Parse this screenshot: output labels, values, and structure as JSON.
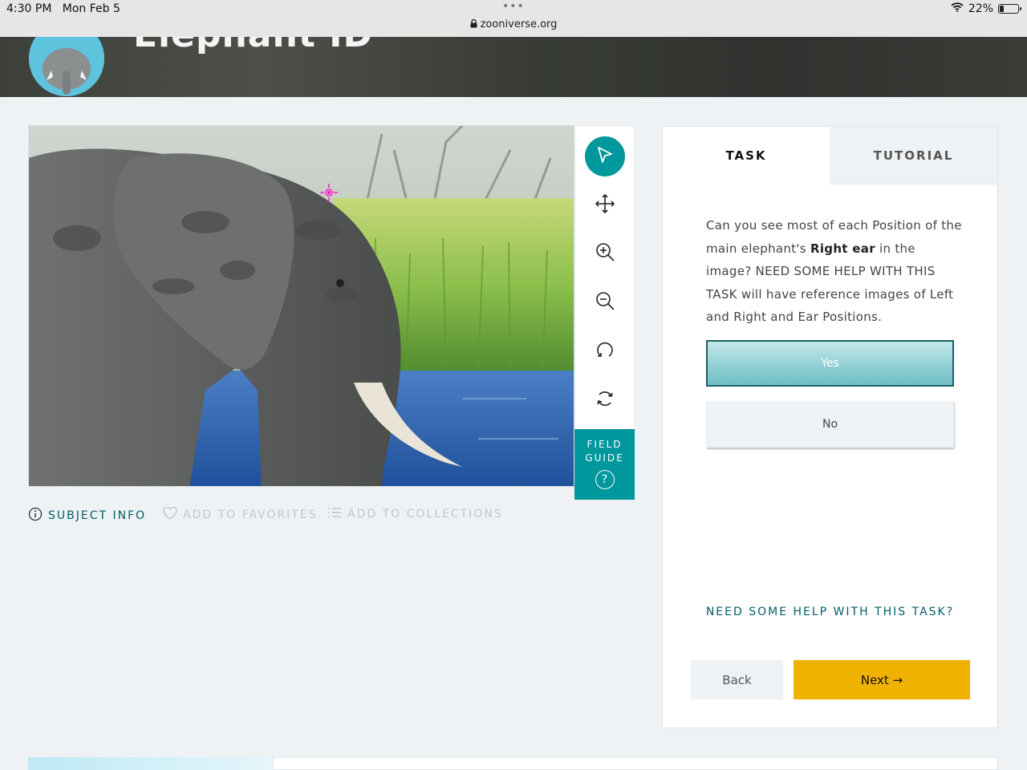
{
  "status_bar": {
    "time": "4:30 PM",
    "date": "Mon Feb 5",
    "dots": "•••",
    "url": "zooniverse.org",
    "battery": "22%",
    "battery_level": 0.22
  },
  "header": {
    "project_title": "Elephant ID"
  },
  "toolbar": {
    "tools": [
      "pointer-icon",
      "move-icon",
      "zoom-in-icon",
      "zoom-out-icon",
      "rotate-icon",
      "reset-icon"
    ],
    "field_guide_line1": "FIELD",
    "field_guide_line2": "GUIDE",
    "field_guide_icon": "?"
  },
  "subject_meta": {
    "subject_info": "SUBJECT INFO",
    "add_to_favorites": "ADD TO FAVORITES",
    "add_to_collections": "ADD TO COLLECTIONS"
  },
  "task_panel": {
    "tabs": [
      "TASK",
      "TUTORIAL"
    ],
    "question": {
      "part1": "Can you see most of each Position of the main elephant's ",
      "bold": "Right ear",
      "part2": " in the image? NEED SOME HELP WITH THIS TASK will have reference images of Left and Right and Ear Positions."
    },
    "answers": [
      "Yes",
      "No"
    ],
    "help_link": "NEED SOME HELP WITH THIS TASK?",
    "back_label": "Back",
    "next_label": "Next →"
  },
  "colors": {
    "teal": "#00979d",
    "dark_teal": "#005d69",
    "next_yellow": "#f0b200",
    "background": "#eef2f5"
  }
}
